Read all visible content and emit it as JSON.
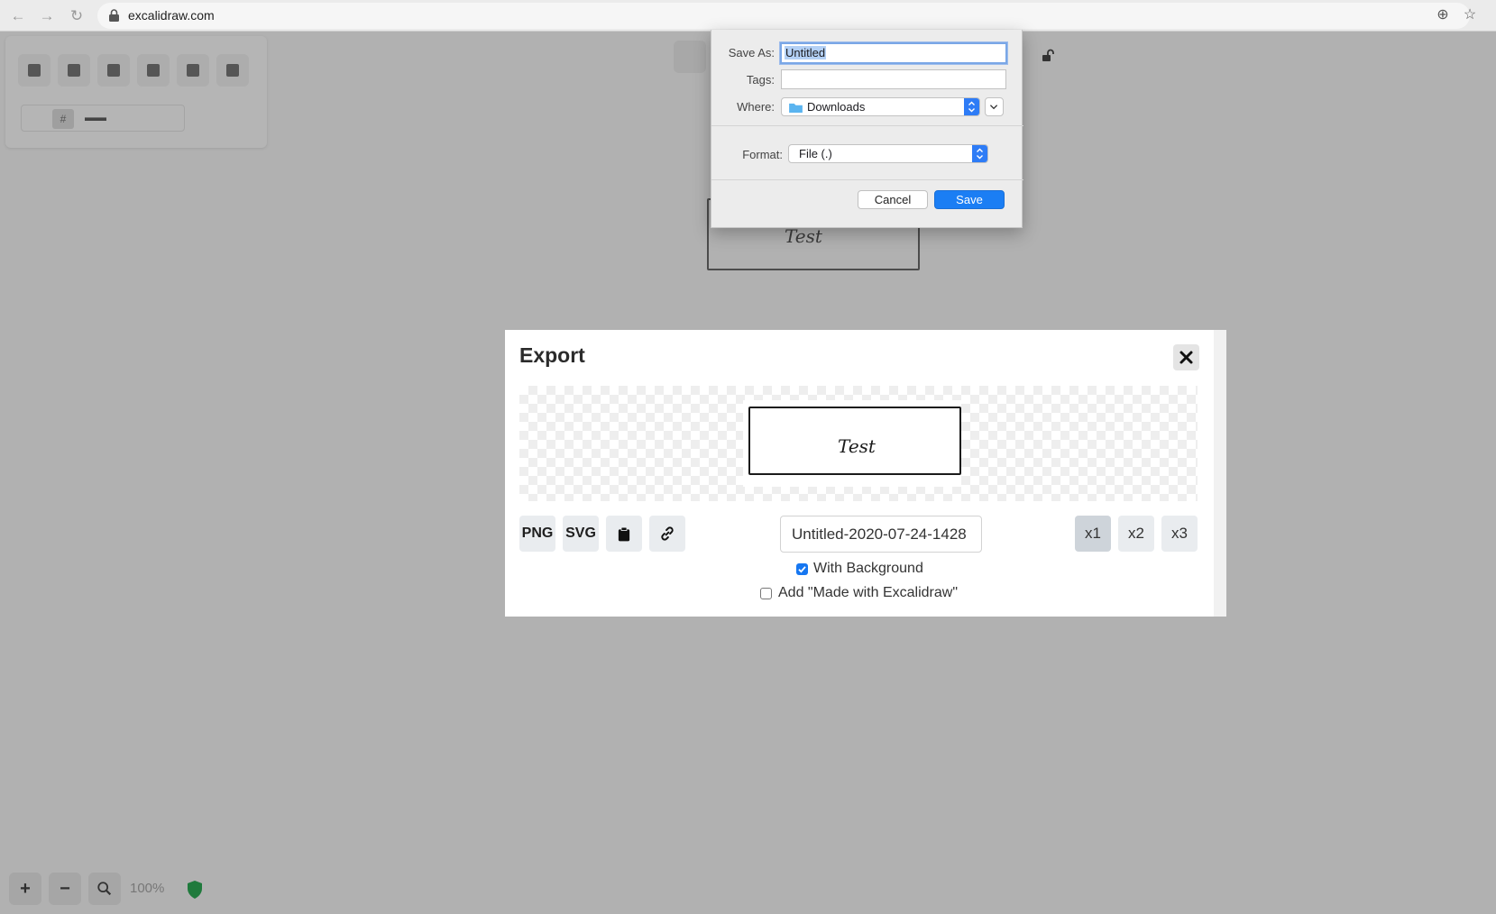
{
  "browser": {
    "url": "excalidraw.com"
  },
  "canvas": {
    "element_text": "Test",
    "zoom_level": "100%"
  },
  "export_dialog": {
    "title": "Export",
    "png_label": "PNG",
    "svg_label": "SVG",
    "filename": "Untitled-2020-07-24-1428",
    "scales": [
      "x1",
      "x2",
      "x3"
    ],
    "active_scale": "x1",
    "with_background_label": "With Background",
    "with_background_checked": true,
    "watermark_label": "Add \"Made with Excalidraw\"",
    "watermark_checked": false,
    "preview_text": "Test"
  },
  "save_sheet": {
    "save_as_label": "Save As:",
    "save_as_value": "Untitled",
    "tags_label": "Tags:",
    "tags_value": "",
    "where_label": "Where:",
    "where_value": "Downloads",
    "format_label": "Format:",
    "format_value": "File (.)",
    "cancel_label": "Cancel",
    "save_label": "Save"
  },
  "colors": {
    "accent": "#1677f1",
    "overlay": "#b1b1b1"
  }
}
